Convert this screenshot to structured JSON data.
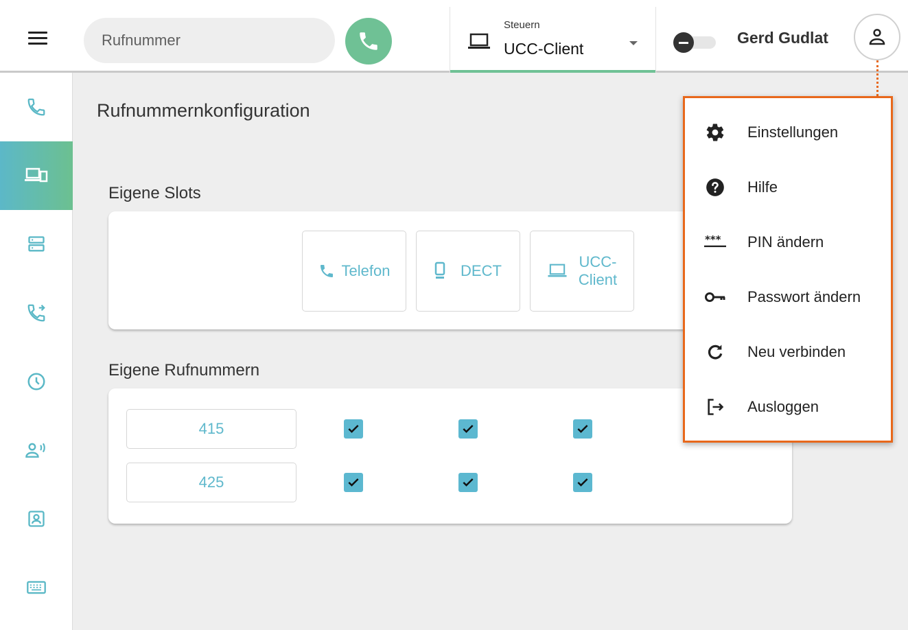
{
  "header": {
    "search_placeholder": "Rufnummer",
    "control_label": "Steuern",
    "control_value": "UCC-Client",
    "user_name": "Gerd Gudlat"
  },
  "sidebar": {
    "items": [
      {
        "icon": "phone-icon"
      },
      {
        "icon": "devices-icon",
        "active": true
      },
      {
        "icon": "server-icon"
      },
      {
        "icon": "call-forward-icon"
      },
      {
        "icon": "history-icon"
      },
      {
        "icon": "presence-icon"
      },
      {
        "icon": "contacts-icon"
      },
      {
        "icon": "keyboard-icon"
      }
    ]
  },
  "main": {
    "page_title": "Rufnummernkonfiguration",
    "slots_title": "Eigene Slots",
    "slots": [
      {
        "label": "Telefon",
        "icon": "phone-icon"
      },
      {
        "label": "DECT",
        "icon": "dect-icon"
      },
      {
        "label": "UCC-\nClient",
        "line1": "UCC-",
        "line2": "Client",
        "icon": "laptop-icon"
      }
    ],
    "numbers_title": "Eigene Rufnummern",
    "numbers": [
      {
        "number": "415",
        "checked": [
          true,
          true,
          true
        ]
      },
      {
        "number": "425",
        "checked": [
          true,
          true,
          true
        ]
      }
    ]
  },
  "menu": {
    "items": [
      {
        "label": "Einstellungen",
        "icon": "gear-icon"
      },
      {
        "label": "Hilfe",
        "icon": "help-icon"
      },
      {
        "label": "PIN ändern",
        "icon": "pin-icon"
      },
      {
        "label": "Passwort ändern",
        "icon": "key-icon"
      },
      {
        "label": "Neu verbinden",
        "icon": "refresh-icon"
      },
      {
        "label": "Ausloggen",
        "icon": "logout-icon"
      }
    ]
  },
  "colors": {
    "accent_green": "#6fc195",
    "accent_blue": "#5fb8cc",
    "menu_border": "#e8681b"
  }
}
